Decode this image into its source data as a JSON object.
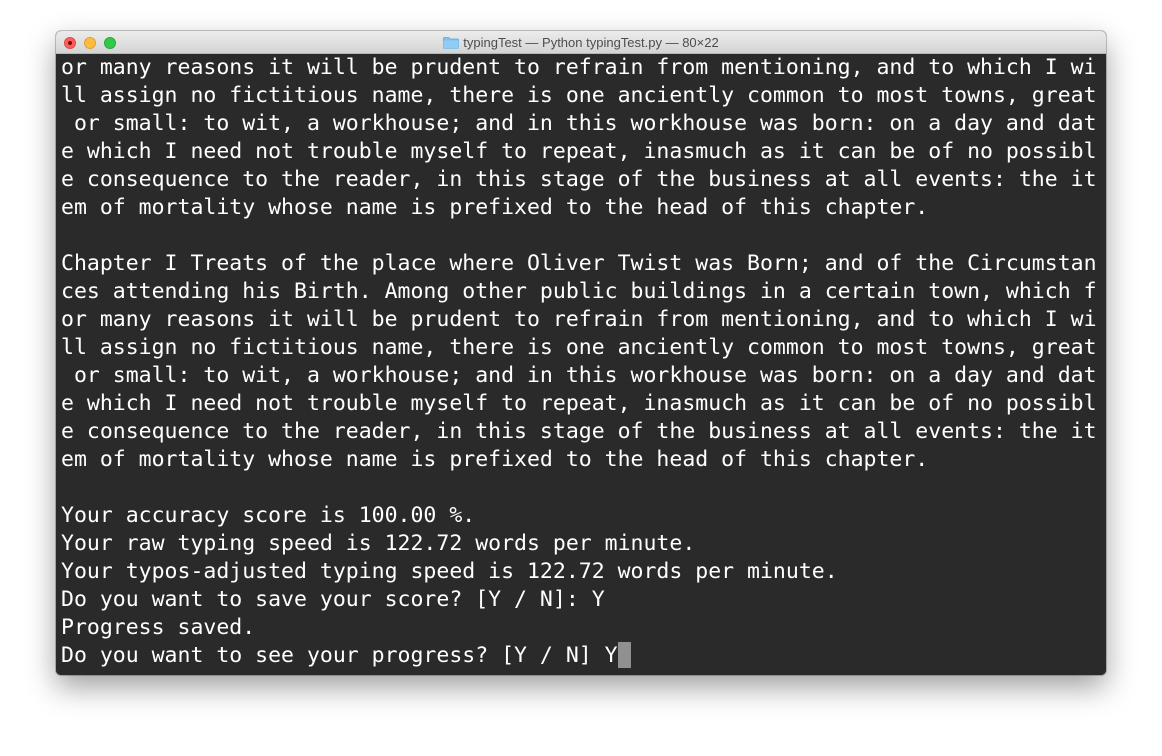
{
  "window": {
    "title": "typingTest — Python typingTest.py — 80×22",
    "folder_icon": "folder-icon"
  },
  "terminal": {
    "lines": [
      "or many reasons it will be prudent to refrain from mentioning, and to which I wi",
      "ll assign no fictitious name, there is one anciently common to most towns, great",
      " or small: to wit, a workhouse; and in this workhouse was born: on a day and dat",
      "e which I need not trouble myself to repeat, inasmuch as it can be of no possibl",
      "e consequence to the reader, in this stage of the business at all events: the it",
      "em of mortality whose name is prefixed to the head of this chapter.",
      "",
      "Chapter I Treats of the place where Oliver Twist was Born; and of the Circumstan",
      "ces attending his Birth. Among other public buildings in a certain town, which f",
      "or many reasons it will be prudent to refrain from mentioning, and to which I wi",
      "ll assign no fictitious name, there is one anciently common to most towns, great",
      " or small: to wit, a workhouse; and in this workhouse was born: on a day and dat",
      "e which I need not trouble myself to repeat, inasmuch as it can be of no possibl",
      "e consequence to the reader, in this stage of the business at all events: the it",
      "em of mortality whose name is prefixed to the head of this chapter.",
      "",
      "Your accuracy score is 100.00 %.",
      "Your raw typing speed is 122.72 words per minute.",
      "Your typos-adjusted typing speed is 122.72 words per minute.",
      "Do you want to save your score? [Y / N]: Y",
      "Progress saved.",
      "Do you want to see your progress? [Y / N] Y"
    ]
  }
}
